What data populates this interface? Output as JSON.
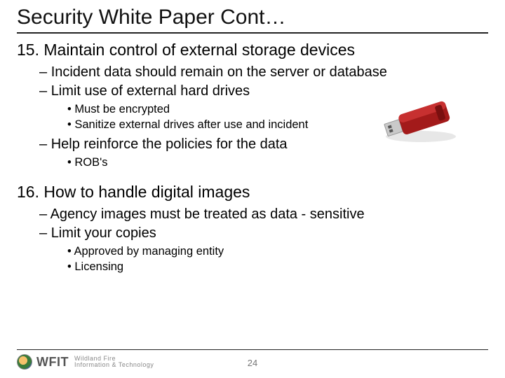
{
  "title": "Security White Paper Cont…",
  "items": [
    {
      "num": "15.",
      "text": "Maintain control of external storage devices",
      "subs": [
        {
          "text": "Incident data should remain on the server or database"
        },
        {
          "text": "Limit use of external hard drives",
          "bullets": [
            "Must be encrypted",
            "Sanitize external drives after use and incident"
          ]
        },
        {
          "text": "Help reinforce the policies for the data",
          "bullets": [
            "ROB's"
          ]
        }
      ]
    },
    {
      "num": "16.",
      "text": "How to handle digital images",
      "subs": [
        {
          "text": "Agency images must be treated as data - sensitive"
        },
        {
          "text": "Limit your copies",
          "bullets": [
            "Approved by managing entity",
            "Licensing"
          ]
        }
      ]
    }
  ],
  "footer": {
    "wfit": "WFIT",
    "line1": "Wildland Fire",
    "line2": "Information & Technology"
  },
  "page_number": "24"
}
